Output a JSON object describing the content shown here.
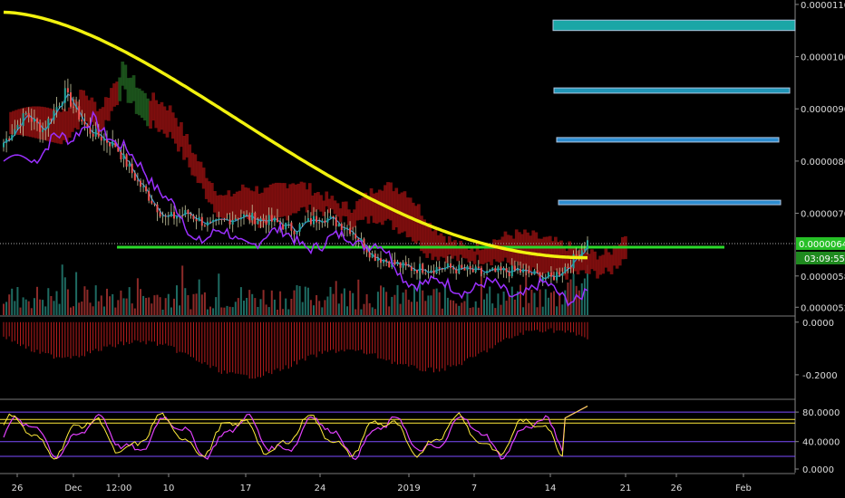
{
  "chart_data": [
    {
      "type": "candlestick",
      "panel": "price",
      "price_axis_ticks": [
        "0.00001100",
        "0.00001000",
        "0.00000900",
        "0.00000800",
        "0.00000700",
        "0.00000580",
        "0.00000520"
      ],
      "ylim": [
        5.05e-06,
        1.105e-05
      ],
      "current_price_label": "0.00000642",
      "current_price": 6.42e-06,
      "countdown_label": "03:09:55",
      "support_level": 6.35e-06,
      "target_zones": [
        {
          "low": 1.05e-05,
          "high": 1.07e-05,
          "color": "#1ba6a6"
        },
        {
          "low": 9.3e-06,
          "high": 9.4e-06,
          "color": "#2196b8"
        },
        {
          "low": 8.4e-06,
          "high": 8.45e-06,
          "color": "#2d8ccf"
        },
        {
          "low": 7.2e-06,
          "high": 7.25e-06,
          "color": "#2d8ccf"
        }
      ],
      "overlays": {
        "moving_average": {
          "color": "#f2f20f"
        },
        "ichimoku_cloud": {
          "bear_color": "#8b0f0f",
          "bull_color": "#1f5c1f"
        },
        "fast_line": {
          "color": "#9b30ff"
        },
        "baseline": {
          "color": "#2f8fcf"
        }
      },
      "colors": {
        "up": "#26a69a",
        "down": "#ef5350",
        "volume_up": "#1e6b62",
        "volume_down": "#8c2a28"
      }
    },
    {
      "type": "bar",
      "panel": "histogram",
      "axis_ticks": [
        "0.0000",
        "-0.2000"
      ],
      "ylim": [
        -0.29,
        0.02
      ],
      "color": "#b71c1c"
    },
    {
      "type": "line",
      "panel": "oscillator",
      "axis_ticks": [
        "80.0000",
        "40.0000",
        "0.0000"
      ],
      "ylim": [
        -2,
        96
      ],
      "series_colors": [
        "#e040fb",
        "#ffeb3b"
      ],
      "levels": [
        {
          "value": 70,
          "color": "#ffeb3b"
        },
        {
          "value": 65,
          "color": "#ffeb3b"
        },
        {
          "value": 80,
          "color": "#7c4dff"
        },
        {
          "value": 40,
          "color": "#7c4dff"
        },
        {
          "value": 20,
          "color": "#7c4dff"
        }
      ]
    }
  ],
  "time_axis": [
    "26",
    "Dec",
    "12:00",
    "10",
    "17",
    "24",
    "2019",
    "7",
    "14",
    "21",
    "26",
    "Feb"
  ]
}
